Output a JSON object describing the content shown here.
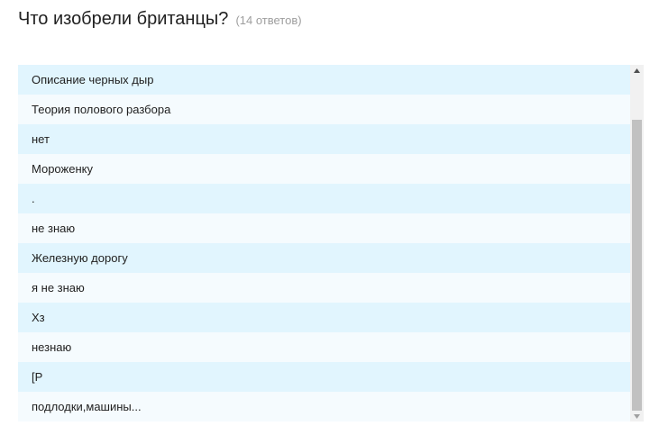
{
  "question": {
    "title": "Что изобрели британцы?",
    "count": "(14 ответов)"
  },
  "responses": [
    "Описание черных дыр",
    "Теория полового разбора",
    "нет",
    "Мороженку",
    ".",
    "не знаю",
    "Железную дорогу",
    "я не знаю",
    "Хз",
    "незнаю",
    "[Р",
    "подлодки,машины..."
  ],
  "scrollbar": {
    "up_icon": "triangle-up-icon",
    "down_icon": "triangle-down-icon"
  },
  "colors": {
    "row_odd": "#e1f5fe",
    "row_even": "#f5fbfe",
    "title": "#212121",
    "count": "#9e9e9e",
    "scroll_thumb": "#c1c1c1"
  }
}
